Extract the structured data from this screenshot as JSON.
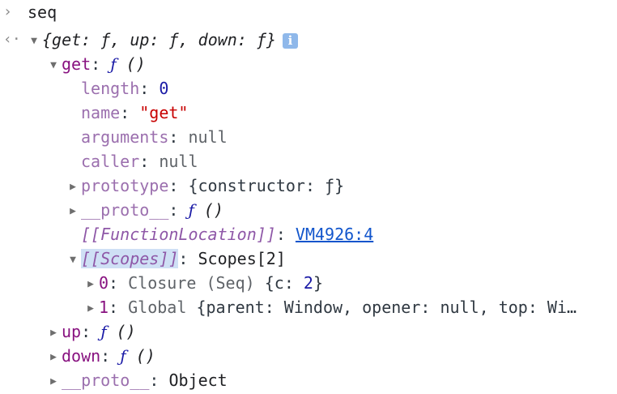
{
  "console": {
    "input": {
      "prompt_glyph": "›",
      "text": "seq"
    },
    "result": {
      "return_glyph": "‹·",
      "preview": "{get: ƒ, up: ƒ, down: ƒ}",
      "info_glyph": "i",
      "get": {
        "key": "get",
        "colon": ":",
        "f": "ƒ",
        "parens": "()",
        "props": {
          "length": {
            "key": "length",
            "value": "0"
          },
          "name": {
            "key": "name",
            "value": "\"get\""
          },
          "arguments": {
            "key": "arguments",
            "value": "null"
          },
          "caller": {
            "key": "caller",
            "value": "null"
          },
          "prototype": {
            "key": "prototype",
            "value": "{constructor: ƒ}"
          },
          "proto": {
            "key": "__proto__",
            "f": "ƒ",
            "parens": "()"
          },
          "function_location": {
            "key": "[[FunctionLocation]]",
            "value": "VM4926:4"
          },
          "scopes": {
            "key": "[[Scopes]]",
            "value": "Scopes[2]",
            "items": [
              {
                "index": "0",
                "label": "Closure (Seq)",
                "preview_open": "{c: ",
                "preview_value": "2",
                "preview_close": "}"
              },
              {
                "index": "1",
                "label": "Global",
                "preview": "{parent: Window, opener: null, top: Wi…"
              }
            ]
          }
        }
      },
      "up": {
        "key": "up",
        "f": "ƒ",
        "parens": "()"
      },
      "down": {
        "key": "down",
        "f": "ƒ",
        "parens": "()"
      },
      "proto": {
        "key": "__proto__",
        "value": "Object"
      }
    }
  }
}
